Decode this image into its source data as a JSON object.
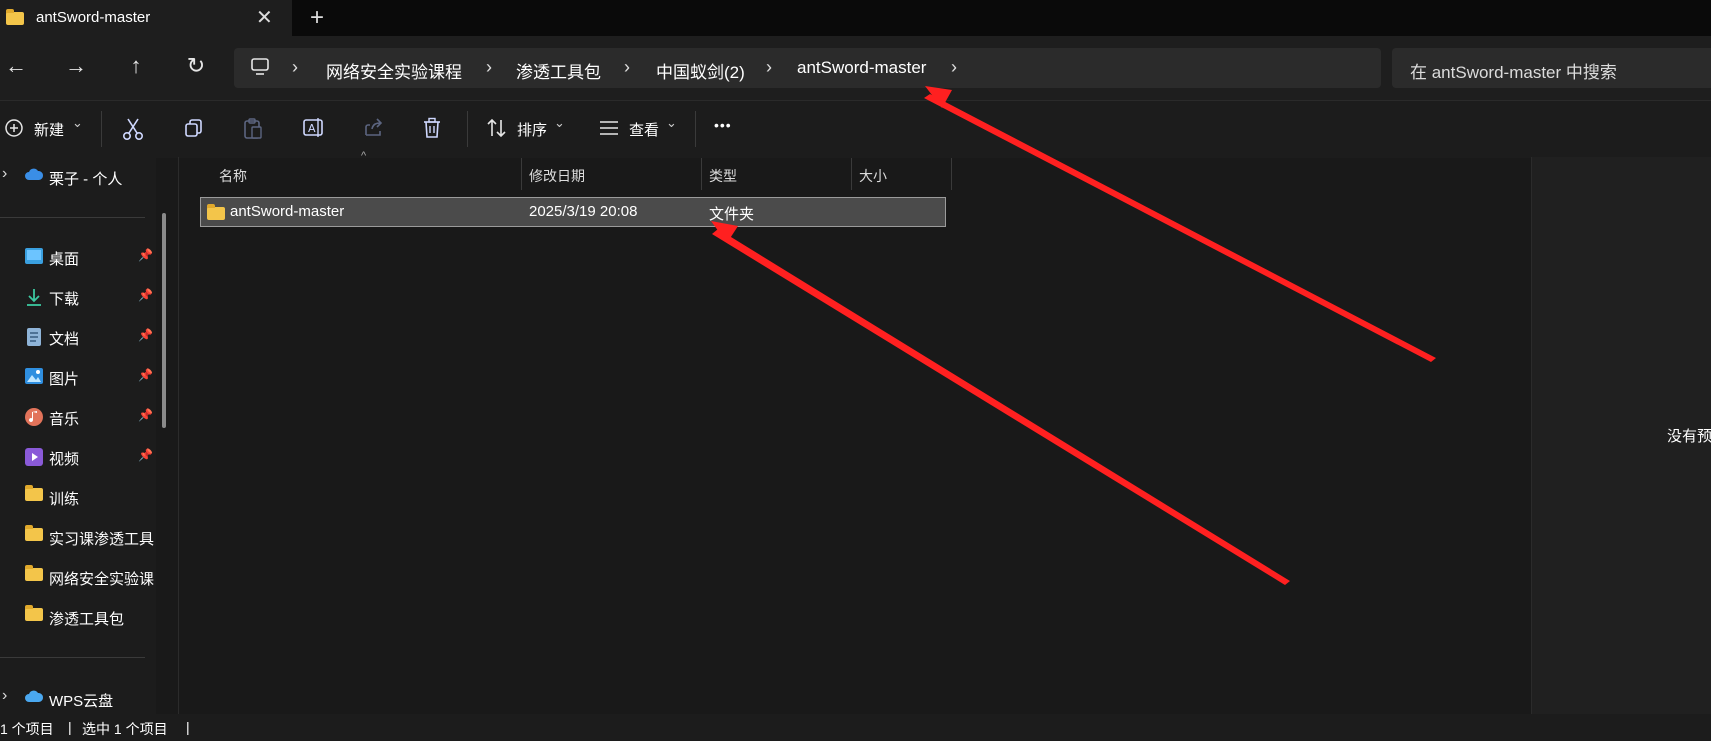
{
  "window": {
    "tab_title": "antSword-master",
    "tab_close_glyph": "✕",
    "new_tab_glyph": "+"
  },
  "nav": {
    "back_glyph": "←",
    "forward_glyph": "→",
    "up_glyph": "↑",
    "refresh_glyph": "↻"
  },
  "breadcrumb": {
    "items": [
      "网络安全实验课程",
      "渗透工具包",
      "中国蚁剑(2)",
      "antSword-master"
    ],
    "separator": "›"
  },
  "search": {
    "placeholder": "在 antSword-master 中搜索"
  },
  "toolbar": {
    "new_label": "新建",
    "sort_label": "排序",
    "view_label": "查看",
    "more_glyph": "•••",
    "chevron": "⌄"
  },
  "sidebar": {
    "onedrive_label": "栗子 - 个人",
    "items": [
      {
        "label": "桌面",
        "icon": "desktop-icon",
        "pinned": true
      },
      {
        "label": "下载",
        "icon": "download-icon",
        "pinned": true
      },
      {
        "label": "文档",
        "icon": "document-icon",
        "pinned": true
      },
      {
        "label": "图片",
        "icon": "picture-icon",
        "pinned": true
      },
      {
        "label": "音乐",
        "icon": "music-icon",
        "pinned": true
      },
      {
        "label": "视频",
        "icon": "video-icon",
        "pinned": true
      },
      {
        "label": "训练",
        "icon": "folder-icon",
        "pinned": false
      },
      {
        "label": "实习课渗透工具",
        "icon": "folder-icon",
        "pinned": false
      },
      {
        "label": "网络安全实验课",
        "icon": "folder-icon",
        "pinned": false
      },
      {
        "label": "渗透工具包",
        "icon": "folder-icon",
        "pinned": false
      }
    ],
    "wps_label": "WPS云盘"
  },
  "file_list": {
    "columns": [
      "名称",
      "修改日期",
      "类型",
      "大小"
    ],
    "rows": [
      {
        "name": "antSword-master",
        "modified": "2025/3/19 20:08",
        "type": "文件夹",
        "size": ""
      }
    ]
  },
  "preview": {
    "text": "没有预"
  },
  "status": {
    "item_count": "1 个项目",
    "selected": "选中 1 个项目",
    "sep": "|"
  },
  "colors": {
    "accent": "#cfd8ff",
    "annotation": "#ff2020",
    "folder": "#f3c54a"
  }
}
